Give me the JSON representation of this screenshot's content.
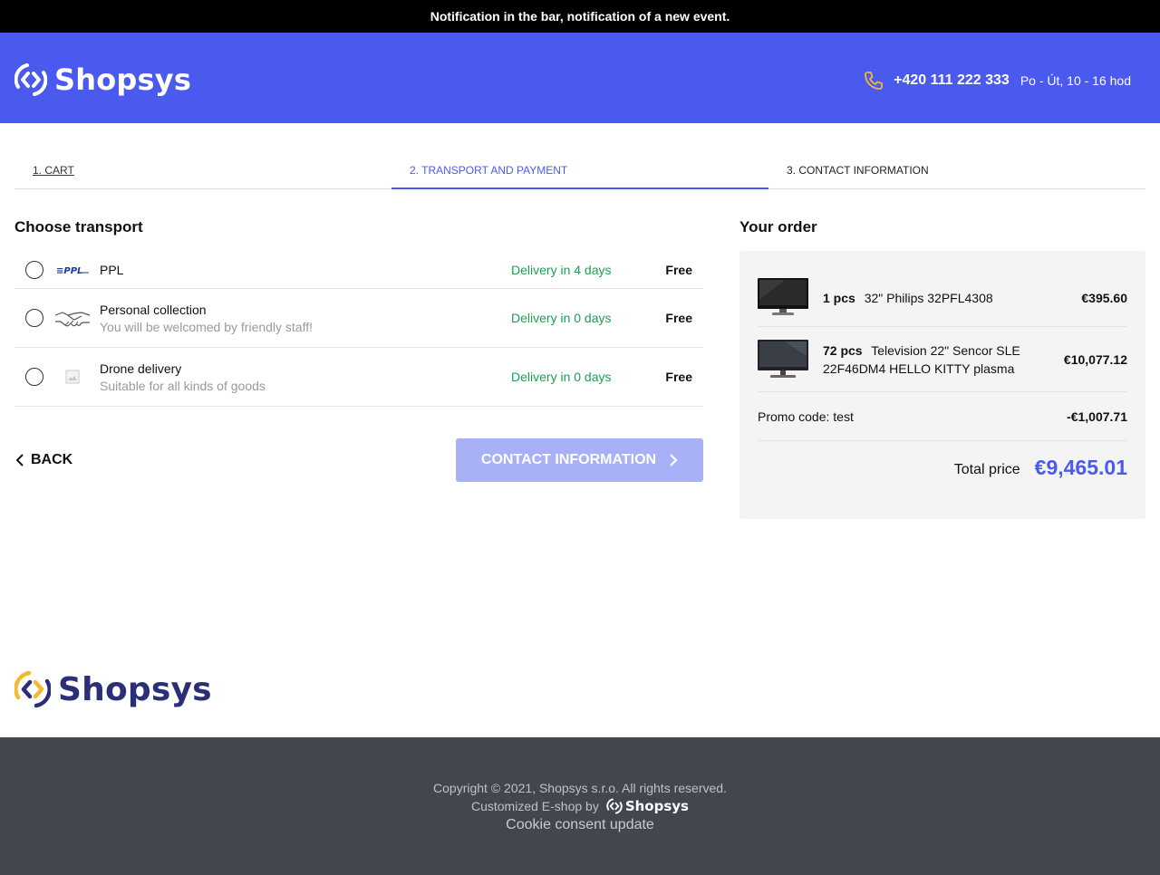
{
  "notification": "Notification in the bar, notification of a new event.",
  "header": {
    "logo_text": "Shopsys",
    "phone": "+420 111 222 333",
    "hours": "Po - Út, 10 - 16 hod"
  },
  "steps": [
    {
      "label": "1. CART"
    },
    {
      "label": "2. TRANSPORT AND PAYMENT"
    },
    {
      "label": "3. CONTACT INFORMATION"
    }
  ],
  "transport": {
    "title": "Choose transport",
    "items": [
      {
        "name": "PPL",
        "description": "",
        "delivery": "Delivery in 4 days",
        "price": "Free",
        "icon": "ppl-logo-icon"
      },
      {
        "name": "Personal collection",
        "description": "You will be welcomed by friendly staff!",
        "delivery": "Delivery in 0 days",
        "price": "Free",
        "icon": "handshake-icon"
      },
      {
        "name": "Drone delivery",
        "description": "Suitable for all kinds of goods",
        "delivery": "Delivery in 0 days",
        "price": "Free",
        "icon": "image-placeholder-icon"
      }
    ]
  },
  "navigation": {
    "back_label": "BACK",
    "next_label": "CONTACT INFORMATION"
  },
  "order": {
    "title": "Your order",
    "items": [
      {
        "qty": "1 pcs",
        "name": "32\" Philips 32PFL4308",
        "price": "€395.60"
      },
      {
        "qty": "72 pcs",
        "name": "Television 22\" Sencor SLE 22F46DM4 HELLO KITTY plasma",
        "price": "€10,077.12"
      }
    ],
    "promo_label": "Promo code: test",
    "promo_discount": "-€1,007.71",
    "total_label": "Total price",
    "total_value": "€9,465.01"
  },
  "footer": {
    "logo_text": "Shopsys",
    "copyright": "Copyright © 2021, Shopsys s.r.o. All rights reserved.",
    "customized_by": "Customized E-shop by",
    "customized_logo_text": "Shopsys",
    "cookie_link": "Cookie consent update"
  },
  "colors": {
    "brand": "#4a5aef",
    "notification_bg": "#000000",
    "delivery_green": "#1f9d55",
    "footer_bg": "#43464f",
    "button_disabled": "#a8b0f8",
    "logo_accent": "#f5b82e"
  }
}
